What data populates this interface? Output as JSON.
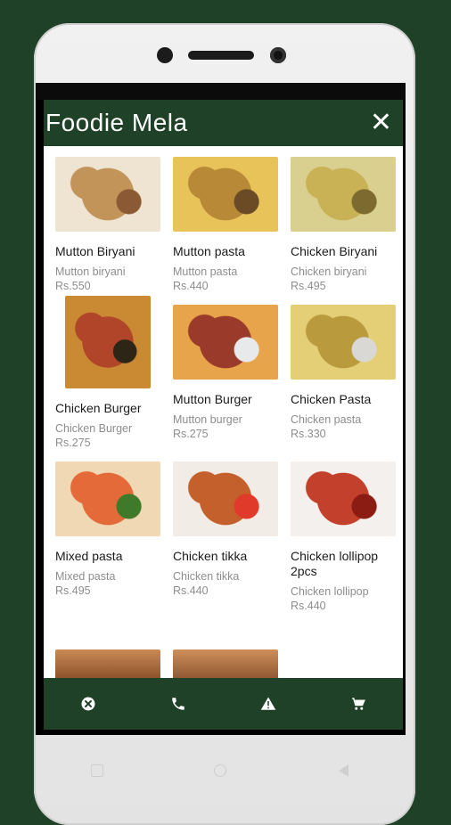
{
  "app": {
    "title": "Foodie Mela",
    "close_icon": "close-icon"
  },
  "menu": [
    {
      "title": "Mutton Biryani",
      "subtitle": "Mutton biryani",
      "price": "Rs.550",
      "colors": [
        "#efe4d2",
        "#c3945a",
        "#8b5a34"
      ]
    },
    {
      "title": "Mutton pasta",
      "subtitle": "Mutton pasta",
      "price": "Rs.440",
      "colors": [
        "#e7c35a",
        "#b88936",
        "#6b4b25"
      ]
    },
    {
      "title": "Chicken Biryani",
      "subtitle": "Chicken biryani",
      "price": "Rs.495",
      "colors": [
        "#d9cf8f",
        "#c9b256",
        "#7c6b2e"
      ]
    },
    {
      "title": "Chicken Burger",
      "subtitle": "Chicken Burger",
      "price": "Rs.275",
      "colors": [
        "#c98a33",
        "#b0452a",
        "#2d2516"
      ]
    },
    {
      "title": "Mutton Burger",
      "subtitle": "Mutton burger",
      "price": "Rs.275",
      "colors": [
        "#e7a44a",
        "#9a3a2a",
        "#e7e9ea"
      ]
    },
    {
      "title": "Chicken Pasta",
      "subtitle": "Chicken pasta",
      "price": "Rs.330",
      "colors": [
        "#e4cf77",
        "#b99b3e",
        "#d9d8d5"
      ]
    },
    {
      "title": "Mixed pasta",
      "subtitle": "Mixed  pasta",
      "price": "Rs.495",
      "colors": [
        "#f0d8b5",
        "#e46a3a",
        "#3f7a2a"
      ]
    },
    {
      "title": "Chicken tikka",
      "subtitle": "Chicken tikka",
      "price": "Rs.440",
      "colors": [
        "#f2ece6",
        "#c4602b",
        "#e03a2b"
      ]
    },
    {
      "title": "Chicken lollipop 2pcs",
      "subtitle": "Chicken lollipop",
      "price": "Rs.440",
      "colors": [
        "#f4f0ed",
        "#c2402c",
        "#8a1c14"
      ]
    }
  ],
  "bottom_nav": [
    {
      "icon": "cancel-circle-icon"
    },
    {
      "icon": "phone-icon"
    },
    {
      "icon": "warning-icon"
    },
    {
      "icon": "cart-icon"
    }
  ],
  "colors": {
    "brand_green": "#1f4127",
    "text_primary": "#1b1b1b",
    "text_secondary": "#8d8d8d"
  }
}
